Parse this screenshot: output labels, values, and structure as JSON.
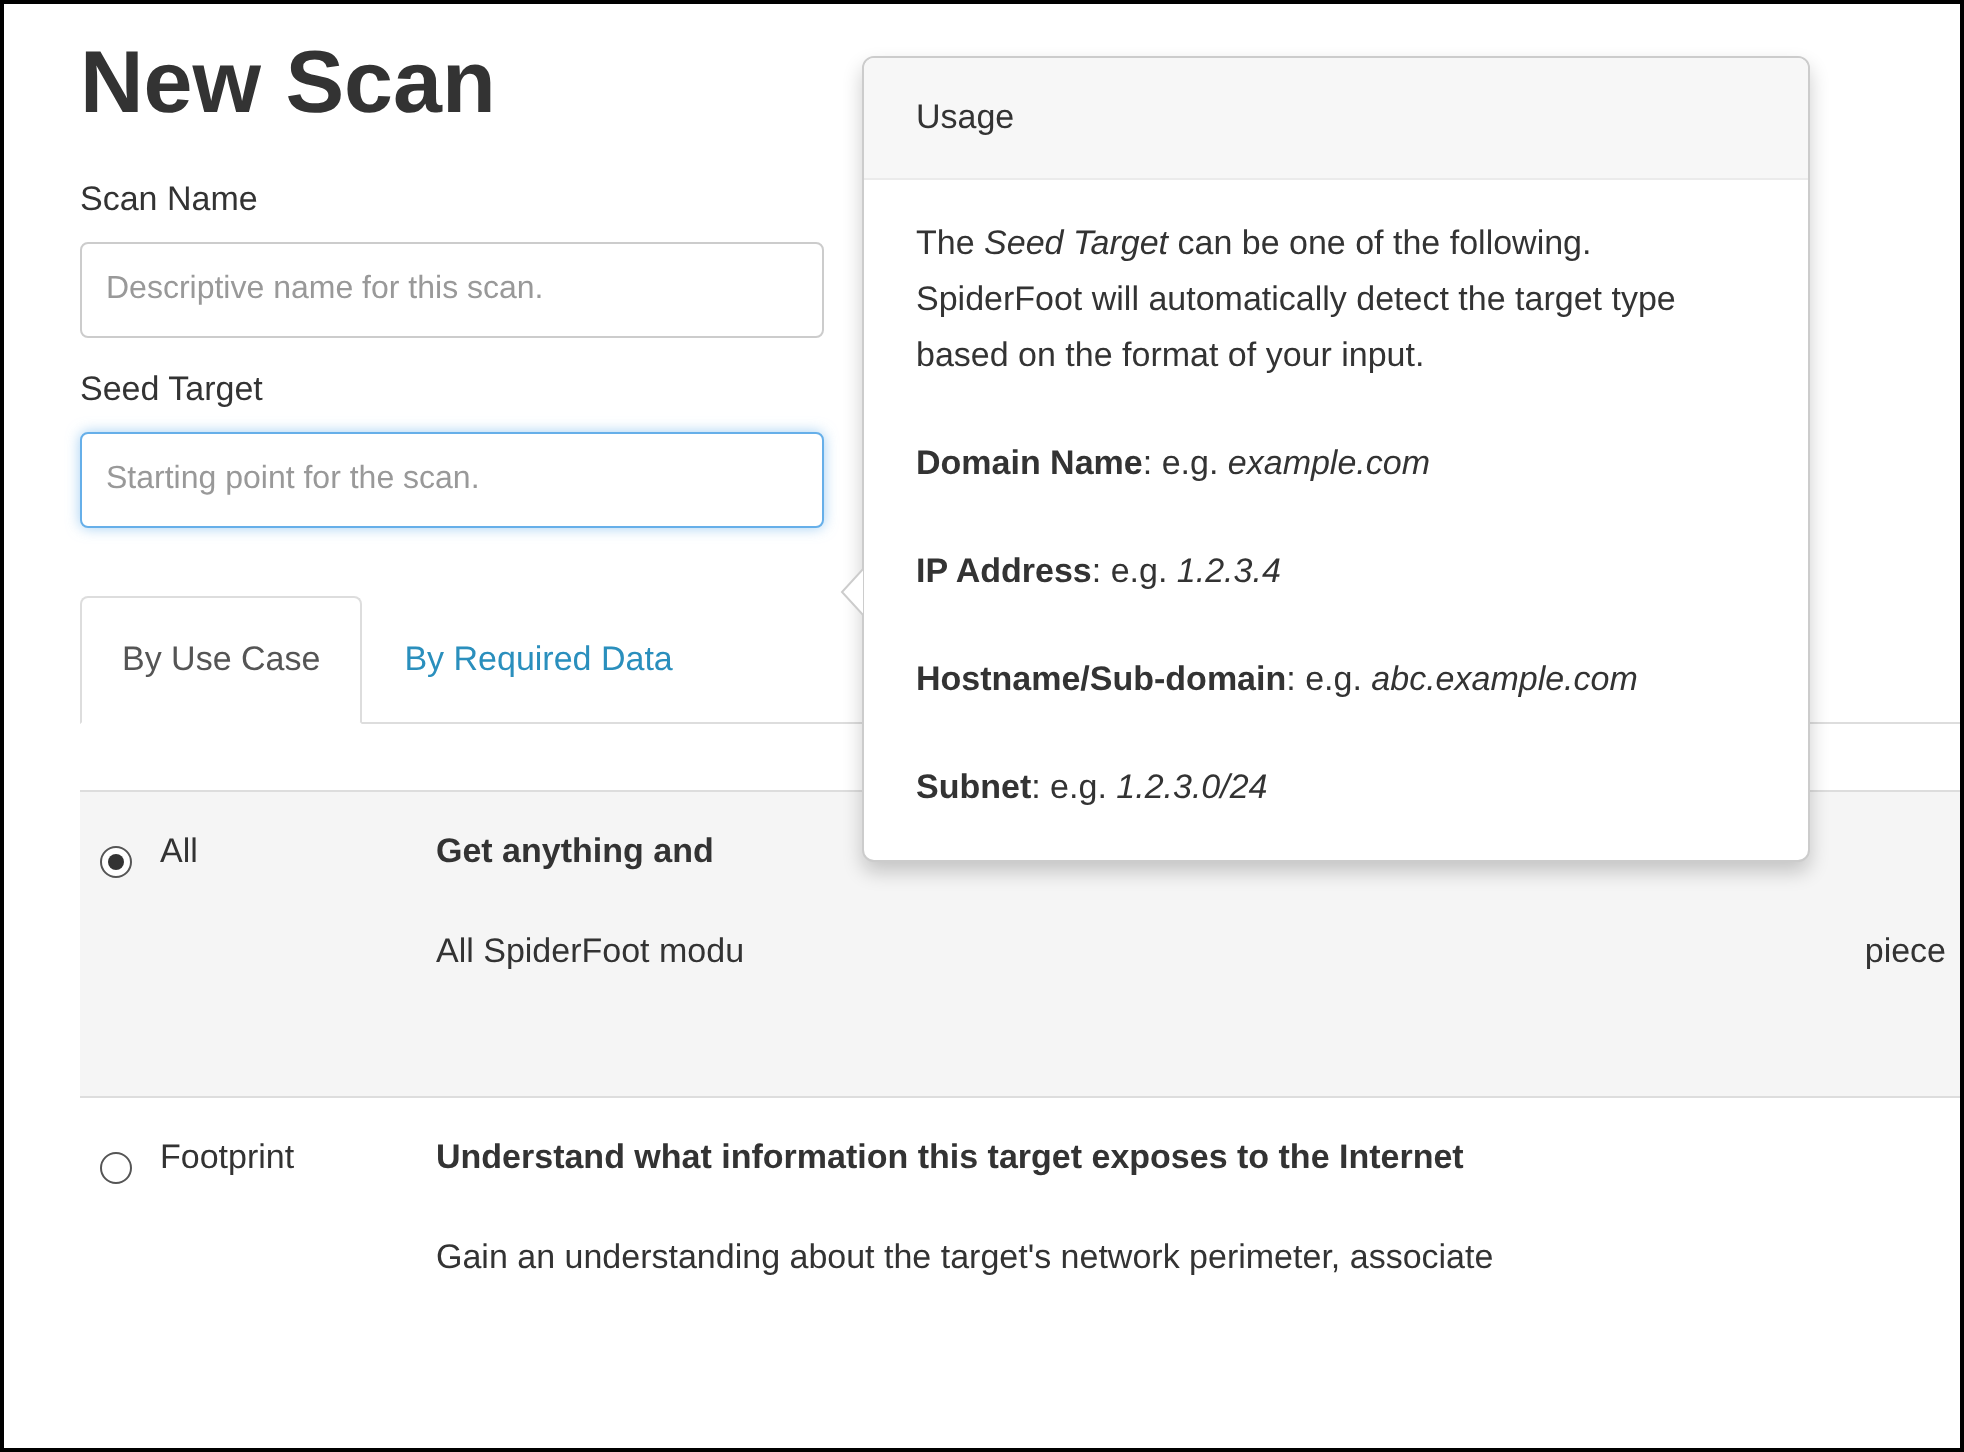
{
  "heading": "New Scan",
  "fields": [
    {
      "label": "Scan Name",
      "placeholder": "Descriptive name for this scan.",
      "focused": false
    },
    {
      "label": "Seed Target",
      "placeholder": "Starting point for the scan.",
      "focused": true
    }
  ],
  "tabs": [
    {
      "label": "By Use Case",
      "selected": true
    },
    {
      "label": "By Required Data",
      "selected": false
    }
  ],
  "use_cases": [
    {
      "name": "All",
      "selected": true,
      "title": "Get anything and",
      "description": "All SpiderFoot modu",
      "description_end": "piece"
    },
    {
      "name": "Footprint",
      "selected": false,
      "title": "Understand what information this target exposes to the Internet",
      "description": "Gain an understanding about the target's network perimeter, associate"
    }
  ],
  "popover": {
    "title": "Usage",
    "intro": "The *Seed Target* can be one of the following. SpiderFoot will automatically detect the target type based on the format of your input.",
    "examples": [
      {
        "text": "**Domain Name**: e.g. *example.com*"
      },
      {
        "text": "**IP Address**: e.g. *1.2.3.4*"
      },
      {
        "text": "**Hostname/Sub-domain**: e.g. *abc.example.com*"
      },
      {
        "text": "**Subnet**: e.g. *1.2.3.0/24*"
      }
    ]
  }
}
